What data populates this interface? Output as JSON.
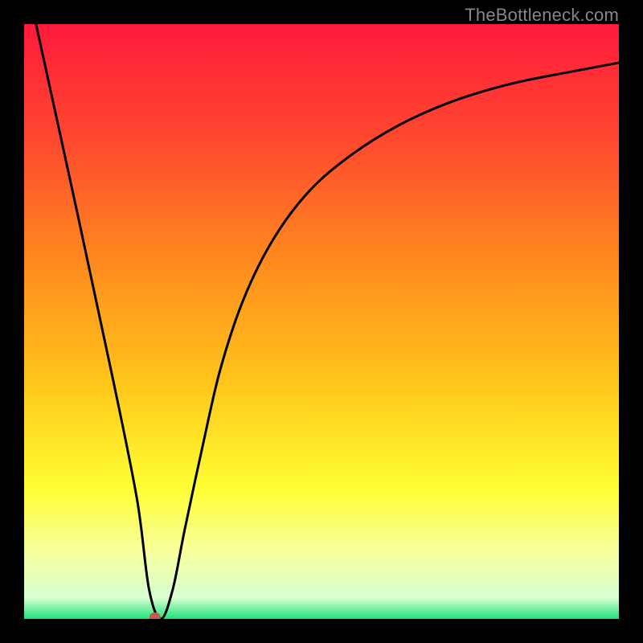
{
  "watermark": "TheBottleneck.com",
  "chart_data": {
    "type": "line",
    "title": "",
    "xlabel": "",
    "ylabel": "",
    "xlim": [
      0,
      100
    ],
    "ylim": [
      0,
      100
    ],
    "background_gradient": {
      "stops": [
        {
          "offset": 0.0,
          "color": "#ff1a3c"
        },
        {
          "offset": 0.2,
          "color": "#ff4a2e"
        },
        {
          "offset": 0.4,
          "color": "#ff8a1e"
        },
        {
          "offset": 0.6,
          "color": "#ffc51a"
        },
        {
          "offset": 0.78,
          "color": "#ffff33"
        },
        {
          "offset": 0.89,
          "color": "#f5ffa0"
        },
        {
          "offset": 0.965,
          "color": "#d6ffd0"
        },
        {
          "offset": 1.0,
          "color": "#1fe27a"
        }
      ]
    },
    "marker": {
      "x": 22,
      "y": 0,
      "color": "#c45a4a",
      "r": 6
    },
    "series": [
      {
        "name": "curve",
        "x": [
          2,
          9,
          15,
          19,
          21,
          23,
          25,
          27,
          30,
          33,
          37,
          42,
          48,
          55,
          63,
          72,
          82,
          92,
          100
        ],
        "values": [
          100,
          68,
          40,
          20,
          5,
          0,
          5,
          15,
          29,
          42,
          54,
          64,
          72,
          78,
          83,
          87,
          90,
          92,
          93.5
        ]
      }
    ]
  }
}
